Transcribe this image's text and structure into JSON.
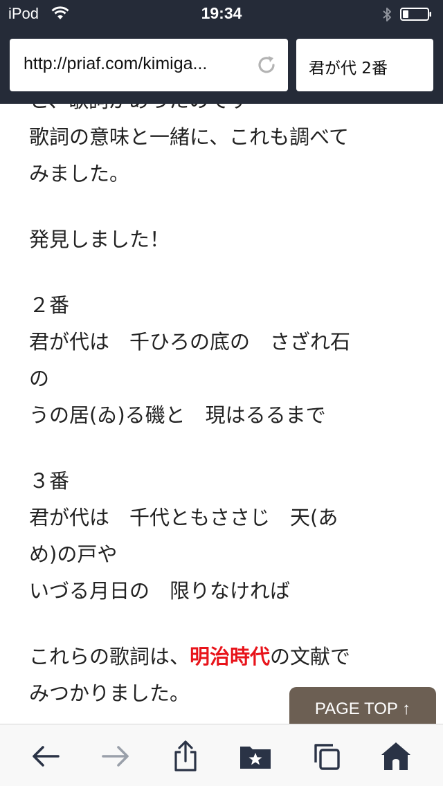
{
  "status": {
    "carrier": "iPod",
    "time": "19:34"
  },
  "browser": {
    "url": "http://priaf.com/kimiga...",
    "search": "君が代 2番"
  },
  "article": {
    "cut_line": "と、歌詞があったのです",
    "para1": [
      "歌詞の意味と一緒に、これも調べて",
      "みました。"
    ],
    "para2": [
      "発見しました！"
    ],
    "verse2": [
      "２番",
      "君が代は　千ひろの底の　さざれ石",
      "の",
      "うの居(ゐ)る磯と　現はるるまで"
    ],
    "verse3": [
      "３番",
      "君が代は　千代ともささじ　天(あ",
      "め)の戸や",
      "いづる月日の　限りなければ"
    ],
    "para_last_pre": "これらの歌詞は、",
    "para_last_highlight": "明治時代",
    "para_last_post": "の文献で",
    "para_last_line2": "みつかりました。"
  },
  "page_top": "PAGE TOP ↑",
  "colors": {
    "topbar": "#252b38",
    "highlight": "#e8141b",
    "page_top_bg": "#6c5f53",
    "toolbar_icon": "#2a3346",
    "toolbar_icon_disabled": "#9aa0aa"
  },
  "toolbar": {
    "icons": [
      "back-arrow-icon",
      "forward-arrow-icon",
      "share-icon",
      "bookmarks-folder-icon",
      "tabs-icon",
      "home-icon"
    ]
  }
}
